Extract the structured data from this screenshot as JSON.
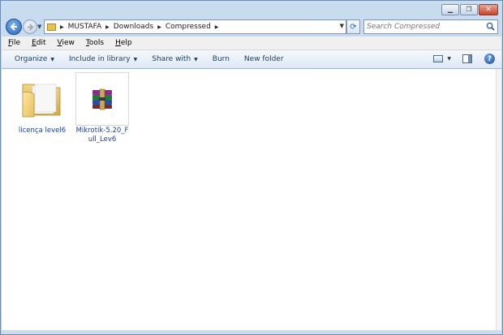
{
  "titlebar": {
    "minimize_glyph": "▁",
    "maximize_glyph": "❐",
    "close_glyph": "✕"
  },
  "navigation": {
    "back_icon": "back-arrow-icon",
    "forward_icon": "forward-arrow-icon",
    "breadcrumbs": [
      "MUSTAFA",
      "Downloads",
      "Compressed"
    ],
    "search_placeholder": "Search Compressed"
  },
  "menubar": {
    "items": [
      {
        "label": "File",
        "accel": "F",
        "rest": "ile"
      },
      {
        "label": "Edit",
        "accel": "E",
        "rest": "dit"
      },
      {
        "label": "View",
        "accel": "V",
        "rest": "iew"
      },
      {
        "label": "Tools",
        "accel": "T",
        "rest": "ools"
      },
      {
        "label": "Help",
        "accel": "H",
        "rest": "elp"
      }
    ]
  },
  "commandbar": {
    "organize": "Organize",
    "include_in_library": "Include in library",
    "share_with": "Share with",
    "burn": "Burn",
    "new_folder": "New folder"
  },
  "files": [
    {
      "name": "licença level6",
      "type": "folder",
      "icon": "folder-icon"
    },
    {
      "name": "Mikrotik-5.20_Full_Lev6",
      "type": "rar-archive",
      "icon": "winrar-archive-icon"
    }
  ],
  "colors": {
    "frame": "#b9d1ea",
    "label_link": "#1c3fa0",
    "close_button": "#c7432c"
  }
}
